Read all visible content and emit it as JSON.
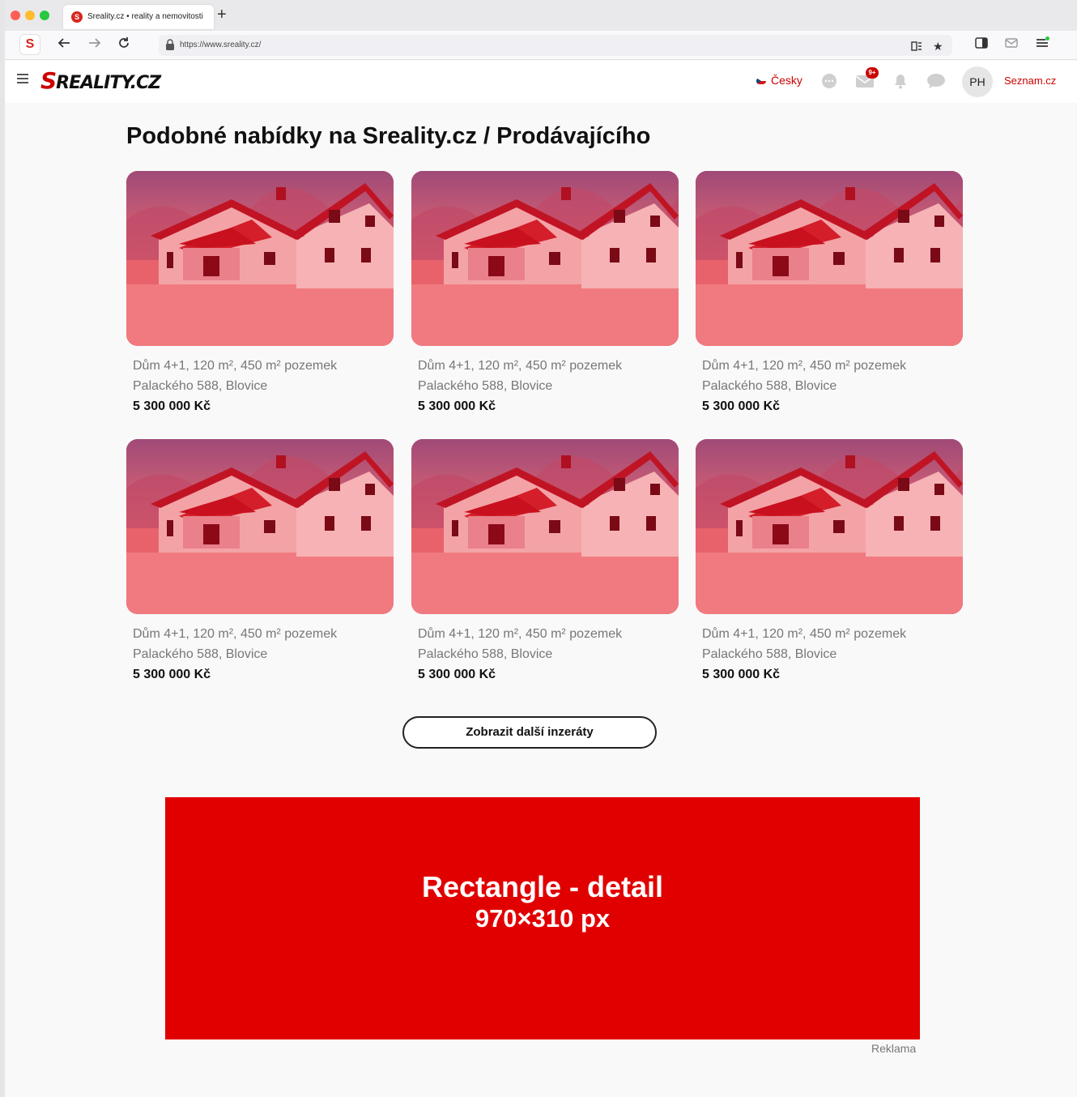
{
  "browser": {
    "tab_title": "Sreality.cz • reality a nemovitosti",
    "url": "https://www.sreality.cz/"
  },
  "header": {
    "logo_text": "REALITY.CZ",
    "logo_initial": "S",
    "language": "Česky",
    "notification_badge": "9+",
    "avatar_initials": "PH",
    "seznam_link": "Seznam.cz"
  },
  "section": {
    "heading": "Podobné nabídky na Sreality.cz / Prodávajícího"
  },
  "listings": [
    {
      "title": "Dům 4+1, 120 m², 450 m² pozemek",
      "address": "Palackého 588, Blovice",
      "price": "5 300 000 Kč"
    },
    {
      "title": "Dům 4+1, 120 m², 450 m² pozemek",
      "address": "Palackého 588, Blovice",
      "price": "5 300 000 Kč"
    },
    {
      "title": "Dům 4+1, 120 m², 450 m² pozemek",
      "address": "Palackého 588, Blovice",
      "price": "5 300 000 Kč"
    },
    {
      "title": "Dům 4+1, 120 m², 450 m² pozemek",
      "address": "Palackého 588, Blovice",
      "price": "5 300 000 Kč"
    },
    {
      "title": "Dům 4+1, 120 m², 450 m² pozemek",
      "address": "Palackého 588, Blovice",
      "price": "5 300 000 Kč"
    },
    {
      "title": "Dům 4+1, 120 m², 450 m² pozemek",
      "address": "Palackého 588, Blovice",
      "price": "5 300 000 Kč"
    }
  ],
  "more_button": "Zobrazit další inzeráty",
  "ad": {
    "title": "Rectangle - detail",
    "size": "970×310 px",
    "label": "Reklama"
  },
  "colors": {
    "brand_red": "#cc0000",
    "ad_red": "#e10000",
    "image_tint": "#e05560"
  },
  "icons": [
    "back-arrow-icon",
    "forward-arrow-icon",
    "reload-icon",
    "lock-icon",
    "reader-mode-icon",
    "bookmark-star-icon",
    "sidebar-icon",
    "mail-icon",
    "menu-icon",
    "hamburger-icon",
    "chat-icon",
    "envelope-icon",
    "bell-icon",
    "message-icon"
  ]
}
